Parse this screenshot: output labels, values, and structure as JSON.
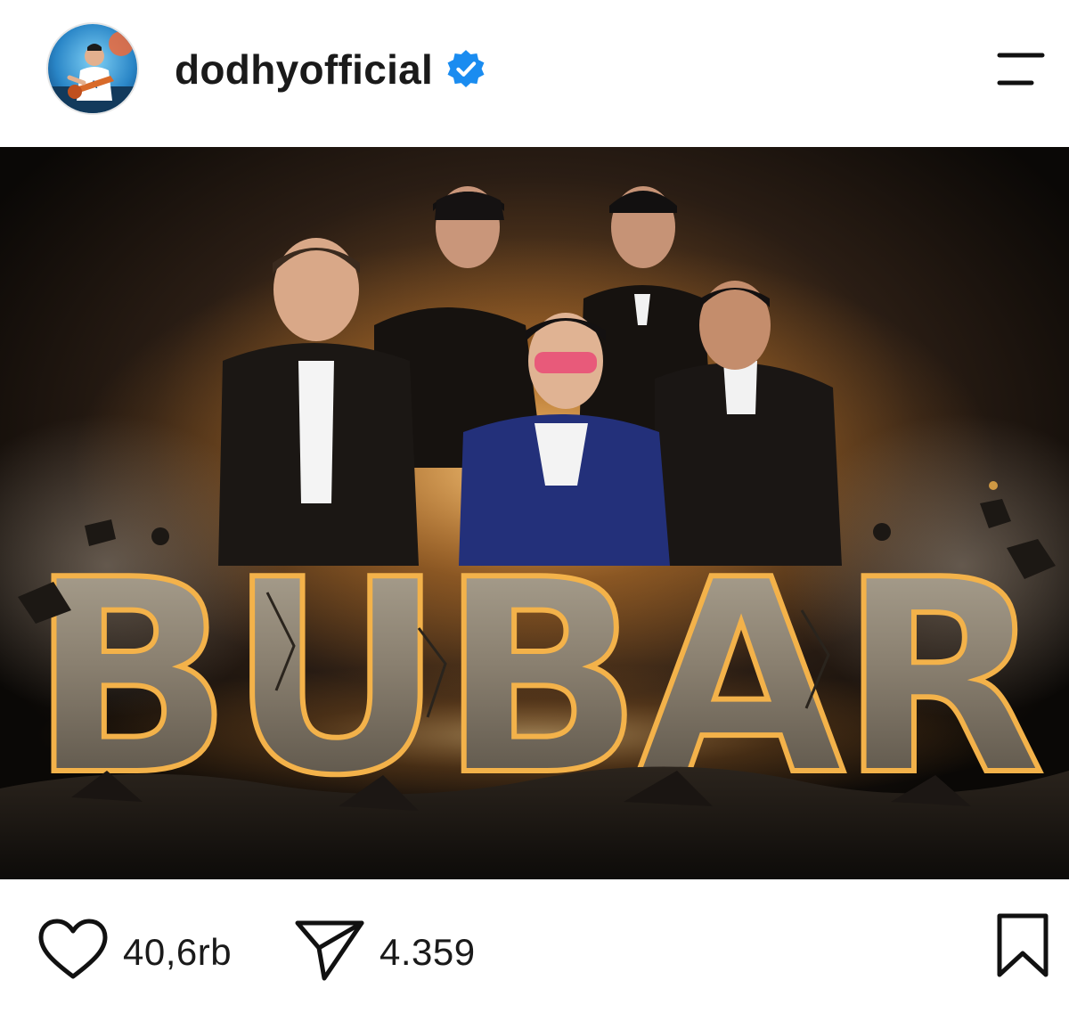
{
  "header": {
    "username": "dodhyofficial",
    "verified": true,
    "menu_icon": "hamburger-menu-icon"
  },
  "post": {
    "image_text": "BUBAR",
    "accent_gold": "#f3b24a",
    "stone_color": "#8a8070"
  },
  "actions": {
    "like_icon": "heart-icon",
    "likes": "40,6rb",
    "share_icon": "send-icon",
    "shares": "4.359",
    "save_icon": "bookmark-icon"
  },
  "colors": {
    "verified_blue": "#1a8cf0",
    "text": "#1a1a1a"
  }
}
